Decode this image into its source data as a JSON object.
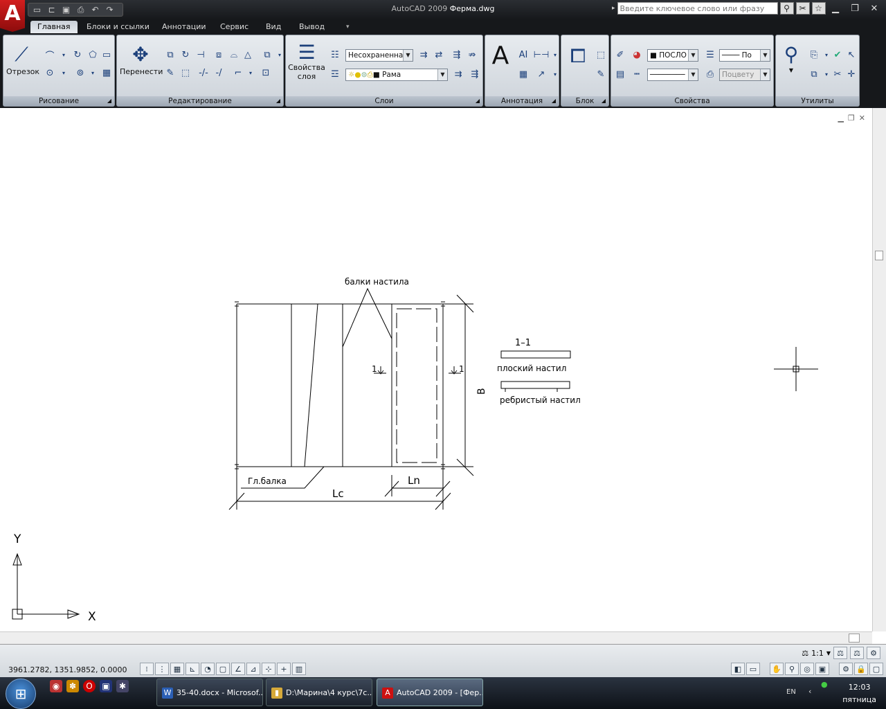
{
  "titlebar": {
    "app_name": "AutoCAD 2009",
    "file_name": "Ферма.dwg",
    "search_placeholder": "Введите ключевое слово или фразу"
  },
  "ribbon_tabs": [
    "Главная",
    "Блоки и ссылки",
    "Аннотации",
    "Сервис",
    "Вид",
    "Вывод"
  ],
  "panels": {
    "draw": {
      "title": "Рисование",
      "line_label": "Отрезок"
    },
    "modify": {
      "title": "Редактирование",
      "move_label": "Перенести"
    },
    "layers": {
      "title": "Слои",
      "props_label_1": "Свойства",
      "props_label_2": "слоя",
      "layer_state": "Несохраненна:",
      "current_layer": "Рама"
    },
    "annotation": {
      "title": "Аннотация"
    },
    "block": {
      "title": "Блок"
    },
    "properties": {
      "title": "Свойства",
      "color": "ПОСЛО",
      "lineweight": "По",
      "plotstyle": "Поцвету"
    },
    "utilities": {
      "title": "Утилиты"
    }
  },
  "drawing": {
    "beams_label": "балки настила",
    "main_beam_label": "Гл.балка",
    "lc_label": "Lc",
    "ln_label": "Ln",
    "b_label": "B",
    "section_mark_left": "1",
    "section_mark_right": "1",
    "section_title": "1–1",
    "flat_deck_label": "плоский настил",
    "ribbed_deck_label": "ребристый настил",
    "ucs_y": "Y",
    "ucs_x": "X"
  },
  "statusbar": {
    "coordinates": "3961.2782, 1351.9852, 0.0000",
    "scale": "1:1"
  },
  "taskbar": {
    "items": [
      {
        "label": "35-40.docx - Microsof...",
        "icon": "W"
      },
      {
        "label": "D:\\Марина\\4 курс\\7с...",
        "icon": "▮"
      },
      {
        "label": "AutoCAD 2009 - [Фер...",
        "icon": "A"
      }
    ],
    "lang": "EN",
    "time": "12:03",
    "day": "пятница"
  }
}
